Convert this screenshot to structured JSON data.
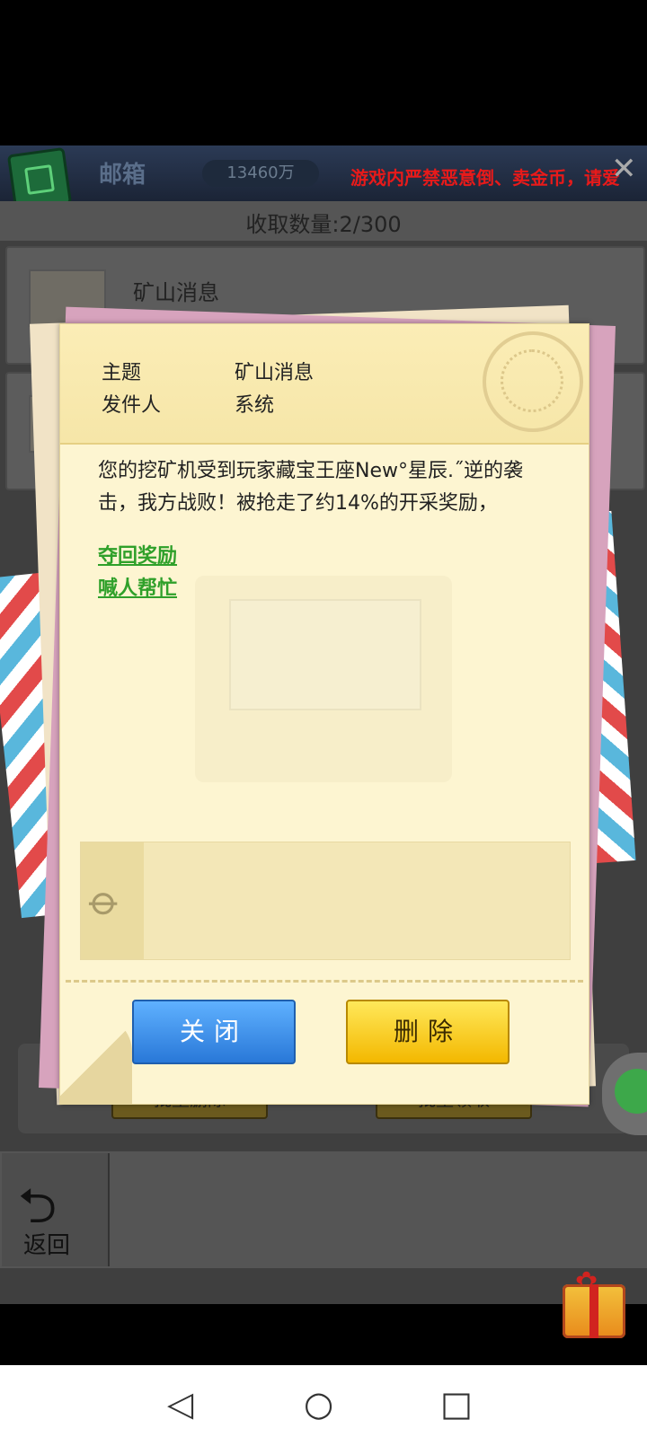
{
  "header": {
    "title": "邮箱",
    "coins": "13460万",
    "ticker": "游戏内严禁恶意倒、卖金币，请爱",
    "count_label": "收取数量:2/300"
  },
  "mail_list": [
    {
      "title": "矿山消息"
    },
    {
      "title": ""
    }
  ],
  "bottom_buttons": {
    "batch_delete": "批量删除",
    "batch_collect": "批量领取"
  },
  "back_label": "返回",
  "dialog": {
    "subject_label": "主题",
    "subject_value": "矿山消息",
    "sender_label": "发件人",
    "sender_value": "系统",
    "body": "您的挖矿机受到玩家藏宝王座New°星辰.˝逆的袭击，我方战败！被抢走了约14%的开采奖励，",
    "link_reclaim": "夺回奖励",
    "link_help": "喊人帮忙",
    "close_label": "关闭",
    "delete_label": "删除"
  },
  "colors": {
    "ticker": "#e81a1a",
    "link": "#2fa02a",
    "close_button": "#3d8fe8",
    "delete_button": "#fcd21b"
  }
}
